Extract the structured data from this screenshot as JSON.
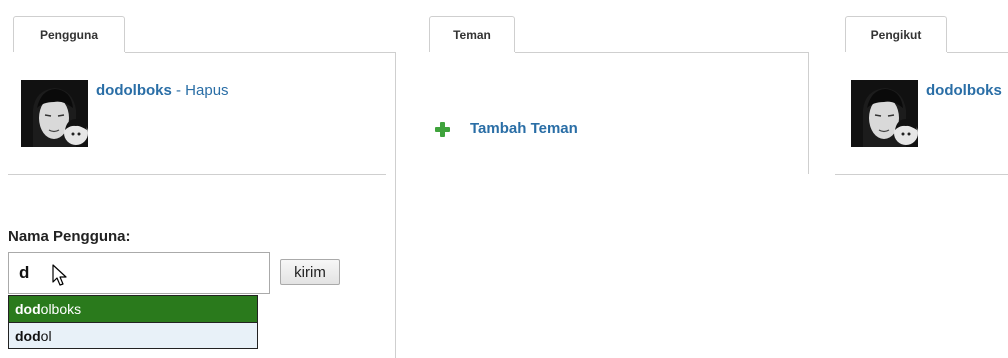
{
  "tabs": [
    {
      "label": "Pengguna"
    },
    {
      "label": "Teman"
    },
    {
      "label": "Pengikut"
    }
  ],
  "users_panel": {
    "username": "dodolboks",
    "separator": " - ",
    "delete_label": "Hapus"
  },
  "friends_panel": {
    "add_friend_label": "Tambah Teman",
    "icon": "plus-icon"
  },
  "followers_panel": {
    "username": "dodolboks"
  },
  "form": {
    "label": "Nama Pengguna:",
    "input_value": "d",
    "submit_label": "kirim"
  },
  "autocomplete": {
    "items": [
      {
        "match": "dod",
        "rest": "olboks"
      },
      {
        "match": "dod",
        "rest": "ol"
      }
    ]
  },
  "colors": {
    "link": "#2a6ea6",
    "suggest_active": "#2a7a1c",
    "suggest_idle": "#e8f1f8",
    "add_icon": "#3fa33c"
  }
}
